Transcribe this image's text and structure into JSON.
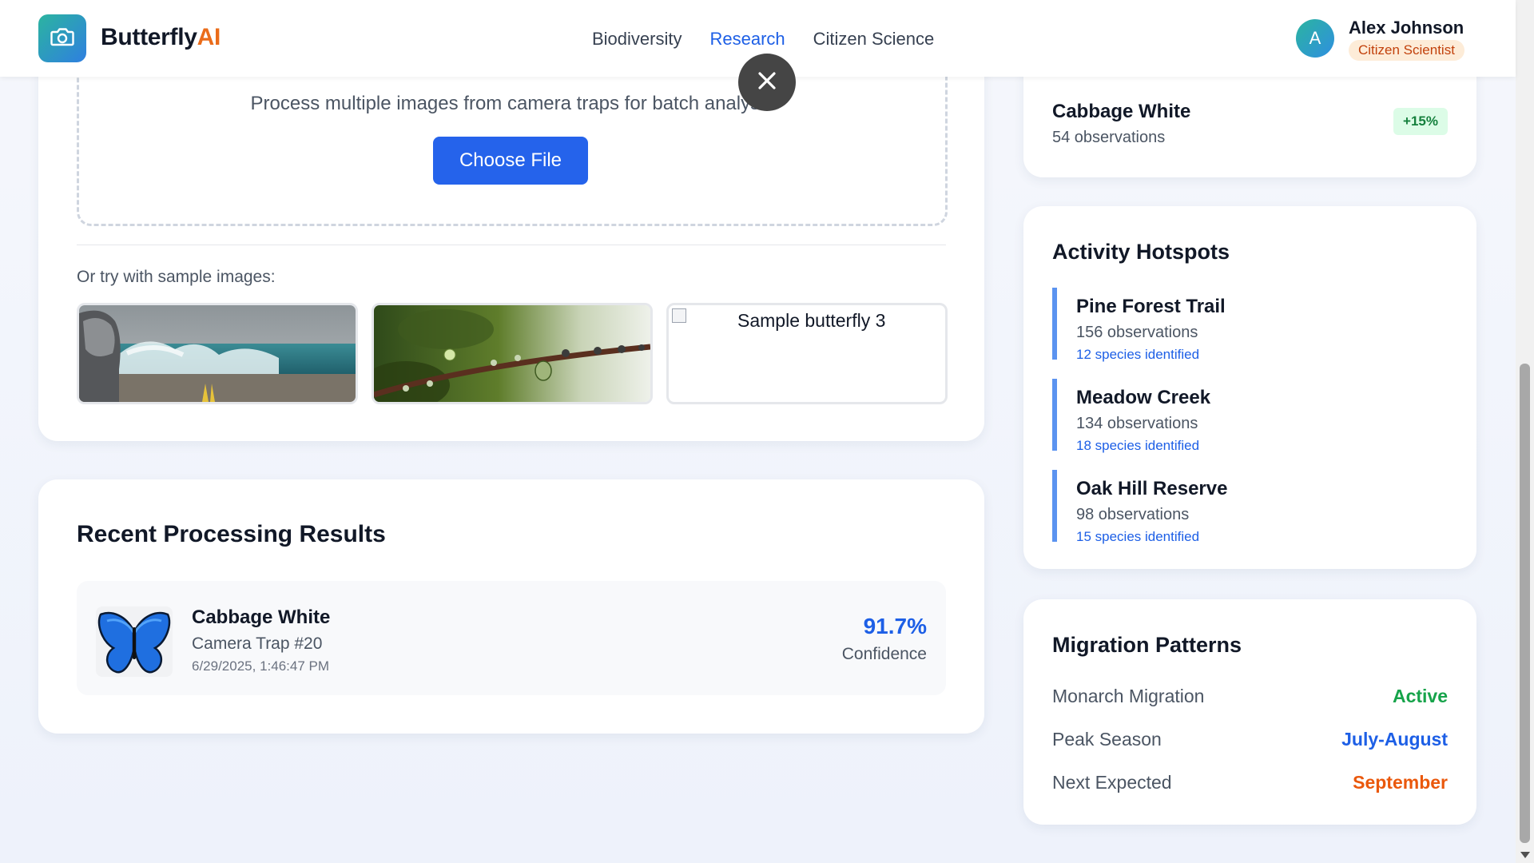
{
  "header": {
    "brand_main": "Butterfly",
    "brand_accent": "AI",
    "logo_icon": "camera-icon",
    "nav": [
      {
        "label": "Biodiversity",
        "active": false
      },
      {
        "label": "Research",
        "active": true
      },
      {
        "label": "Citizen Science",
        "active": false
      }
    ],
    "user": {
      "initial": "A",
      "name": "Alex Johnson",
      "role": "Citizen Scientist"
    }
  },
  "upload": {
    "description": "Process multiple images from camera traps for batch analysis",
    "button_label": "Choose File",
    "sample_label": "Or try with sample images:",
    "samples": [
      {
        "alt": "",
        "icon": "sample-ocean-wave-image"
      },
      {
        "alt": "",
        "icon": "sample-water-droplet-branch-image"
      },
      {
        "alt": "Sample butterfly 3",
        "icon": "broken-image-icon"
      }
    ]
  },
  "recent": {
    "title": "Recent Processing Results",
    "items": [
      {
        "species": "Cabbage White",
        "source": "Camera Trap #20",
        "timestamp": "6/29/2025, 1:46:47 PM",
        "confidence": "91.7%",
        "confidence_label": "Confidence"
      }
    ]
  },
  "species_trend": {
    "name": "Cabbage White",
    "observations": "54 observations",
    "change": "+15%"
  },
  "hotspots": {
    "title": "Activity Hotspots",
    "items": [
      {
        "name": "Pine Forest Trail",
        "observations": "156 observations",
        "species": "12 species identified"
      },
      {
        "name": "Meadow Creek",
        "observations": "134 observations",
        "species": "18 species identified"
      },
      {
        "name": "Oak Hill Reserve",
        "observations": "98 observations",
        "species": "15 species identified"
      }
    ]
  },
  "migration": {
    "title": "Migration Patterns",
    "rows": [
      {
        "label": "Monarch Migration",
        "value": "Active",
        "color": "#16a34a"
      },
      {
        "label": "Peak Season",
        "value": "July-August",
        "color": "#1d5fe6"
      },
      {
        "label": "Next Expected",
        "value": "September",
        "color": "#ea580c"
      }
    ]
  },
  "colors": {
    "primary": "#2563eb",
    "accent": "#ea6c1a",
    "hotspot_border": "#5b93f0"
  }
}
